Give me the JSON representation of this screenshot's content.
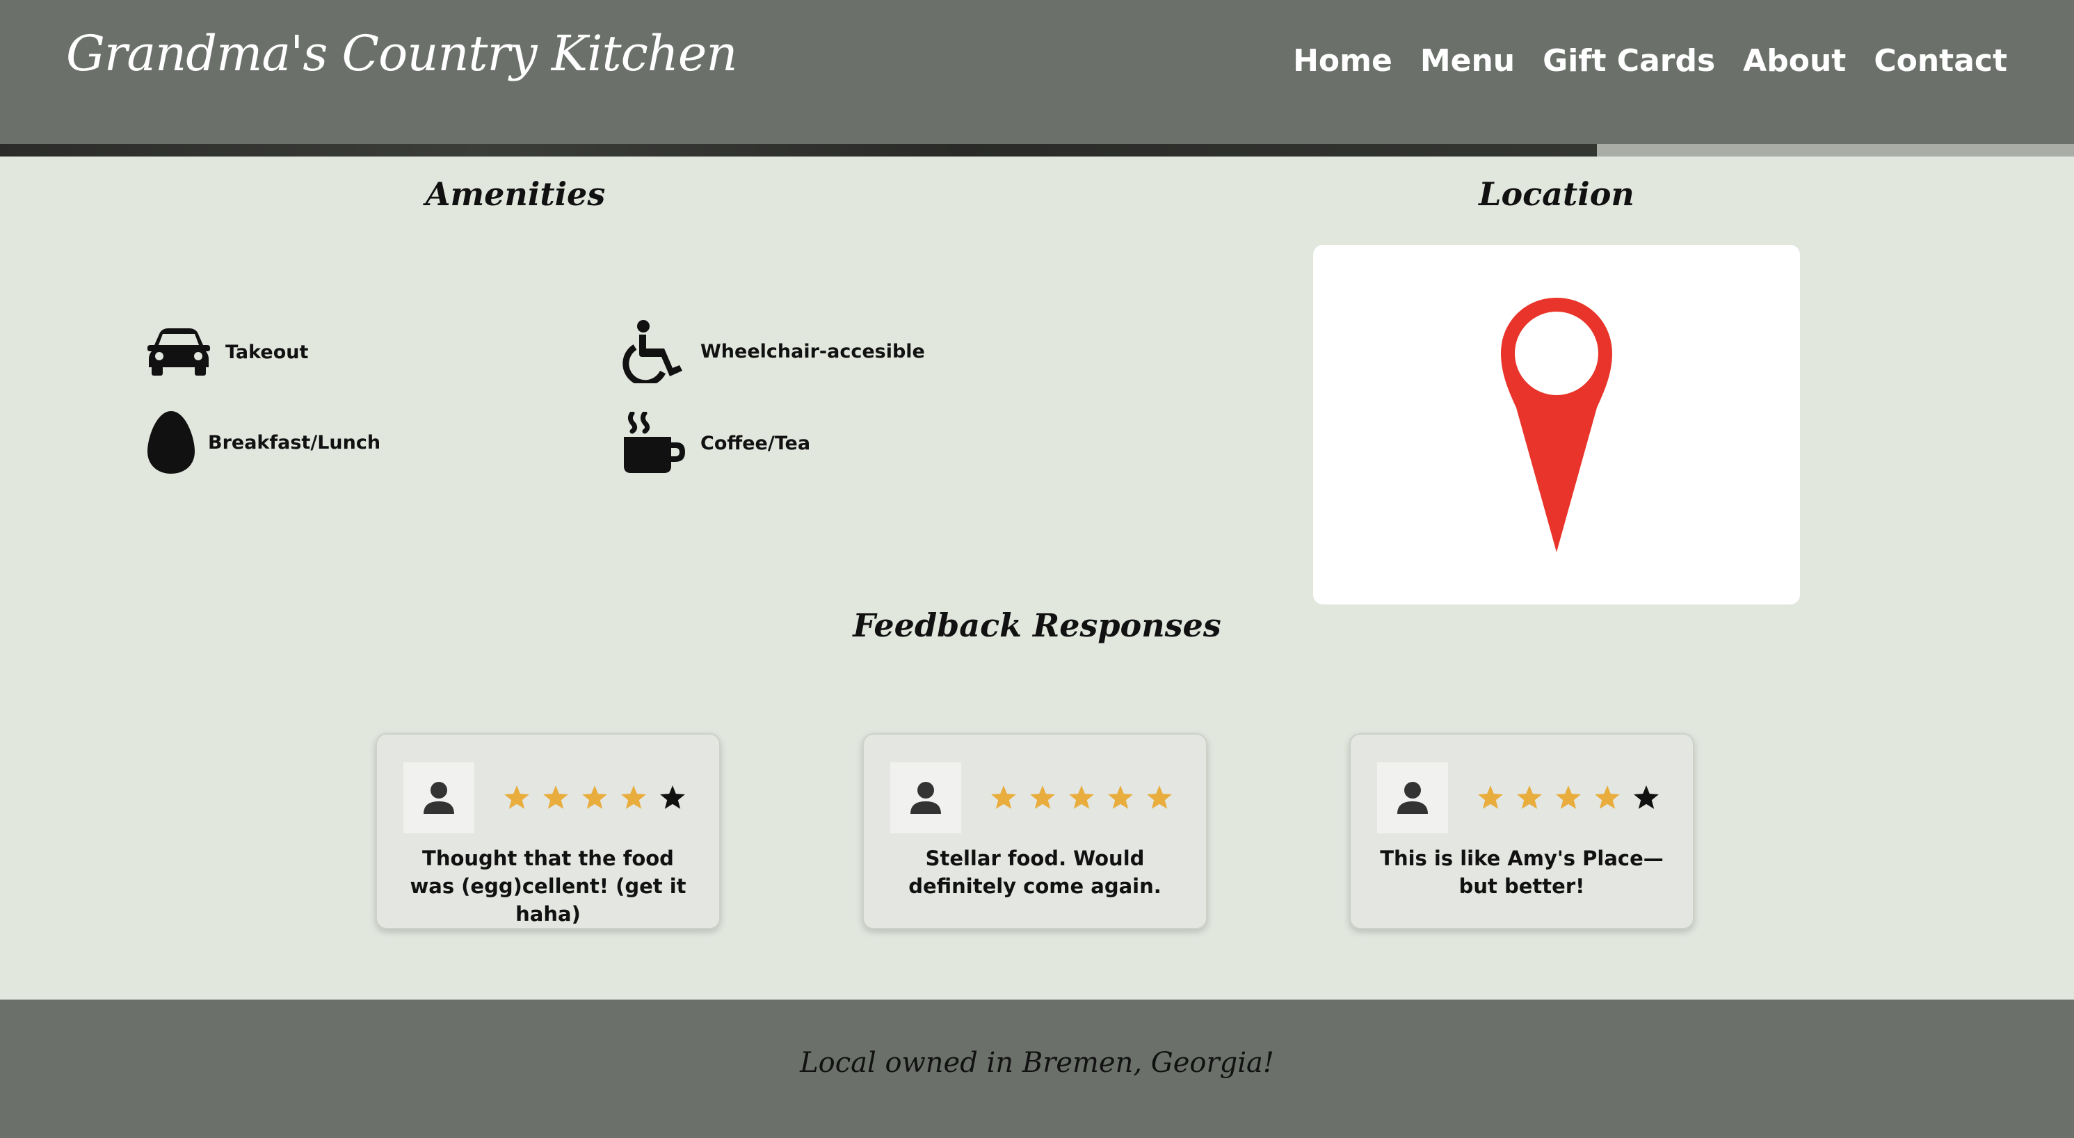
{
  "header": {
    "site_title": "Grandma's Country Kitchen",
    "nav": [
      "Home",
      "Menu",
      "Gift Cards",
      "About",
      "Contact"
    ]
  },
  "amenities": {
    "heading": "Amenities",
    "items": [
      {
        "icon": "car-icon",
        "label": "Takeout"
      },
      {
        "icon": "wheelchair-icon",
        "label": "Wheelchair-accesible"
      },
      {
        "icon": "egg-icon",
        "label": "Breakfast/Lunch"
      },
      {
        "icon": "coffee-cup-icon",
        "label": "Coffee/Tea"
      }
    ]
  },
  "location": {
    "heading": "Location",
    "icon": "map-pin-icon",
    "pin_color": "#e8342a"
  },
  "feedback": {
    "heading": "Feedback Responses",
    "star_color": "#e8ad3d",
    "responses": [
      {
        "rating": 4,
        "text": "Thought that the food was (egg)cellent! (get it haha)"
      },
      {
        "rating": 5,
        "text": "Stellar food. Would definitely come again."
      },
      {
        "rating": 4,
        "text": "This is like Amy's Place—but better!"
      }
    ]
  },
  "footer": {
    "text": "Local owned in Bremen, Georgia!"
  },
  "colors": {
    "header_bg": "#6b716a",
    "page_bg": "#e2e7de"
  }
}
